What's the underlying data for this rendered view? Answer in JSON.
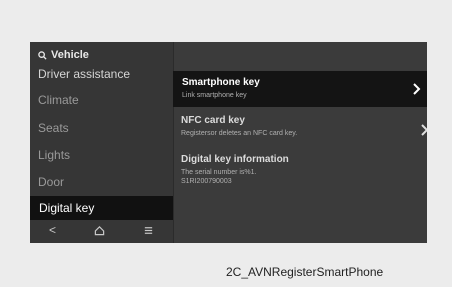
{
  "search": {
    "label": "Vehicle"
  },
  "sidebar": {
    "items": [
      {
        "label": "Driver assistance"
      },
      {
        "label": "Climate"
      },
      {
        "label": "Seats"
      },
      {
        "label": "Lights"
      },
      {
        "label": "Door"
      },
      {
        "label": "Digital key"
      }
    ]
  },
  "bottom_bar": {
    "back_icon": "<",
    "home_icon": "home-icon",
    "menu_icon": "menu-icon"
  },
  "content": {
    "items": [
      {
        "title": "Smartphone key",
        "subtitle": "Link smartphone key"
      },
      {
        "title": "NFC card key",
        "subtitle": "Registersor deletes an NFC card key."
      },
      {
        "title": "Digital key information",
        "subtitle": "The serial number is%1.",
        "subtitle2": "S1RI200790003"
      }
    ]
  },
  "caption": "2C_AVNRegisterSmartPhone"
}
